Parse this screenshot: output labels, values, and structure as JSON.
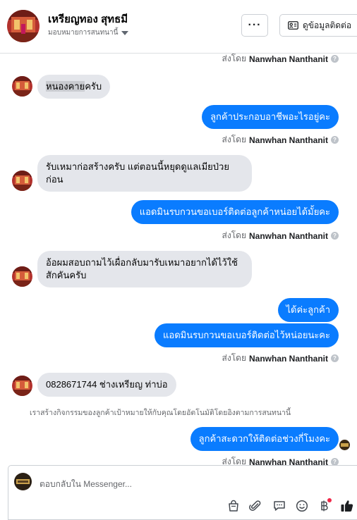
{
  "header": {
    "name": "เหรียญทอง สุทธมี",
    "subtitle": "มอบหมายการสนทนานี้",
    "more_label": "···",
    "contact_label": "ดูข้อมูลติดต่อ"
  },
  "sent_by_prefix": "ส่งโดย",
  "agent_name": "Nanwhan Nanthanit",
  "messages": {
    "m1_pre": "หนองคาย",
    "m1_post": "ครับ",
    "m2": "ลูกค้าประกอบอาชีพอะไรอยู่คะ",
    "m3": "รับเหมาก่อสร้างครับ แต่ตอนนี้หยุดดูแลเมียป่วยก่อน",
    "m4": "แอดมินรบกวนขอเบอร์ติดต่อลูกค้าหน่อยได้มั้ยคะ",
    "m5": "อ้อผมสอบถามไว้เผื่อกลับมารับเหมาอยากได้ไว้ใช้สักคันครับ",
    "m6": "ได้ค่ะลูกค้า",
    "m7": "แอดมินรบกวนขอเบอร์ติดต่อไว้หน่อยนะคะ",
    "m8": "0828671744 ช่างเหรียญ ท่าบ่อ",
    "m9": "ลูกค้าสะดวกให้ติดต่อช่วงกี่โมงคะ"
  },
  "notice": "เราสร้างกิจกรรมของลูกค้าเป้าหมายให้กับคุณโดยอัตโนมัติโดยอิงตามการสนทนานี้",
  "composer": {
    "placeholder": "ตอบกลับใน Messenger..."
  },
  "icons": [
    "ellipsis-icon",
    "contact-card-icon",
    "chevron-down-icon",
    "shopping-bag-icon",
    "paperclip-icon",
    "saved-reply-icon",
    "emoji-icon",
    "baht-payment-icon",
    "thumbs-up-icon"
  ],
  "colors": {
    "outgoing_bubble": "#0a7cff",
    "incoming_bubble": "#e4e6eb",
    "like_icon": "#1c1e21",
    "notification_dot": "#f02849"
  }
}
